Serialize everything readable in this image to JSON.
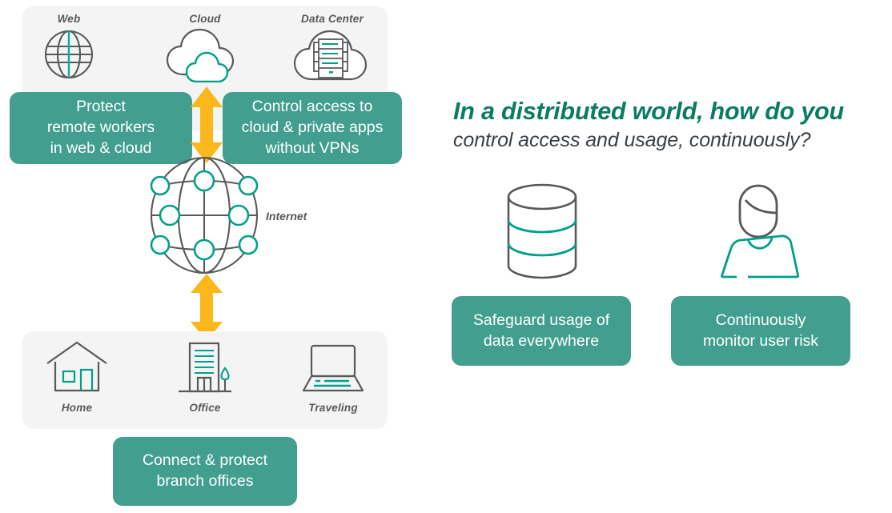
{
  "colors": {
    "teal_box": "#429e8f",
    "teal_accent": "#00a08a",
    "heading_teal": "#0b7b63",
    "gray_line": "#58595b",
    "arrow_yellow": "#fbb81c",
    "panel_bg": "#f4f4f4"
  },
  "left_diagram": {
    "top_panel": {
      "nodes": [
        {
          "label": "Web",
          "icon": "globe-web-icon"
        },
        {
          "label": "Cloud",
          "icon": "cloud-icon"
        },
        {
          "label": "Data Center",
          "icon": "data-center-cloud-server-icon"
        }
      ]
    },
    "bottom_panel": {
      "nodes": [
        {
          "label": "Home",
          "icon": "house-icon"
        },
        {
          "label": "Office",
          "icon": "office-building-icon"
        },
        {
          "label": "Traveling",
          "icon": "laptop-icon"
        }
      ]
    },
    "internet": {
      "label": "Internet",
      "icon": "internet-globe-nodes-icon"
    },
    "arrows": [
      {
        "name": "arrow-top",
        "icon": "double-arrow-vertical-icon"
      },
      {
        "name": "arrow-bottom",
        "icon": "double-arrow-vertical-icon"
      }
    ],
    "callouts": [
      {
        "id": "protect",
        "text": "Protect\nremote workers\nin web & cloud"
      },
      {
        "id": "control",
        "text": "Control access to\ncloud & private apps\nwithout VPNs"
      },
      {
        "id": "branch",
        "text": "Connect & protect\nbranch offices"
      }
    ]
  },
  "right_panel": {
    "headline": {
      "line1": "In a distributed world, how do you",
      "line2": "control access  and usage, continuously?"
    },
    "items": [
      {
        "id": "safeguard",
        "icon": "database-cylinder-icon",
        "text": "Safeguard usage of\ndata everywhere"
      },
      {
        "id": "monitor",
        "icon": "user-person-icon",
        "text": "Continuously\nmonitor user risk"
      }
    ]
  }
}
